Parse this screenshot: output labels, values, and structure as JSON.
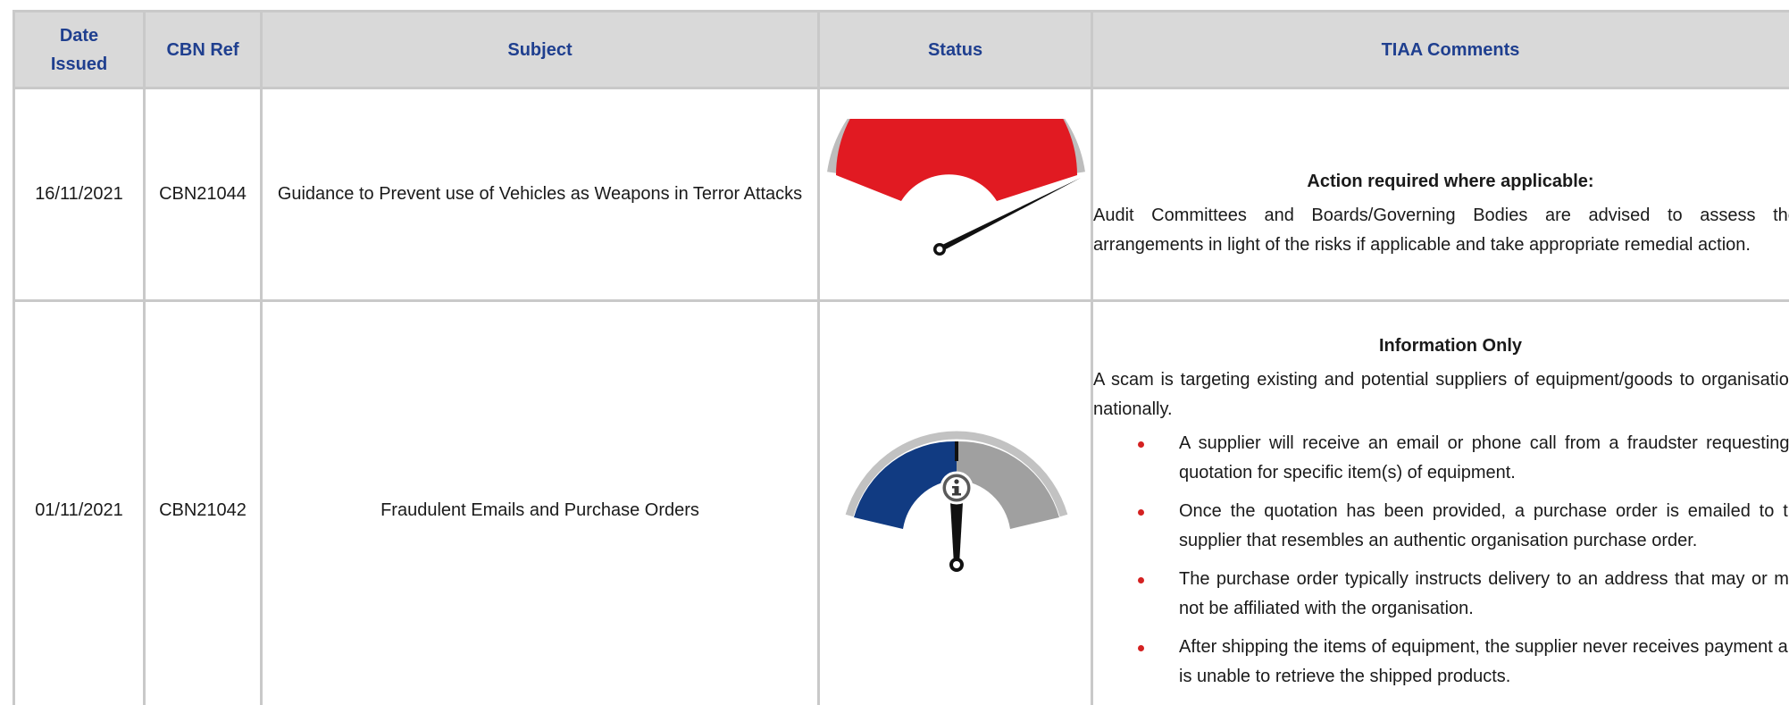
{
  "table": {
    "headers": {
      "date": "Date Issued",
      "ref": "CBN Ref",
      "subject": "Subject",
      "status": "Status",
      "comments": "TIAA Comments"
    },
    "rows": [
      {
        "date": "16/11/2021",
        "ref": "CBN21044",
        "subject": "Guidance to Prevent use of Vehicles as Weapons in Terror Attacks",
        "status_icon": "red-gauge-icon",
        "comment_heading": "Action required where applicable:",
        "comment_text": "Audit Committees and Boards/Governing Bodies are advised to assess their arrangements in light of the risks if applicable and take appropriate remedial action."
      },
      {
        "date": "01/11/2021",
        "ref": "CBN21042",
        "subject": "Fraudulent Emails and Purchase Orders",
        "status_icon": "info-gauge-icon",
        "comment_heading": "Information Only",
        "comment_text": "A scam is targeting existing and potential suppliers of equipment/goods to organisations nationally.",
        "comment_bullets": [
          "A supplier will receive an email or phone call from a fraudster requesting a quotation for specific item(s) of equipment.",
          "Once the quotation has been provided, a purchase order is emailed to the supplier that resembles an authentic organisation purchase order.",
          "The purchase order typically instructs delivery to an address that may or may not be affiliated with the organisation.",
          "After shipping the items of equipment, the supplier never receives payment and is unable to retrieve the shipped products."
        ]
      }
    ]
  },
  "colors": {
    "header_bg": "#d9d9d9",
    "header_text": "#1f3f8f",
    "border": "#c9c9c9",
    "gauge_red": "#e11a22",
    "gauge_blue": "#113b82",
    "gauge_grey": "#a0a0a0",
    "bullet_red": "#d42121"
  }
}
